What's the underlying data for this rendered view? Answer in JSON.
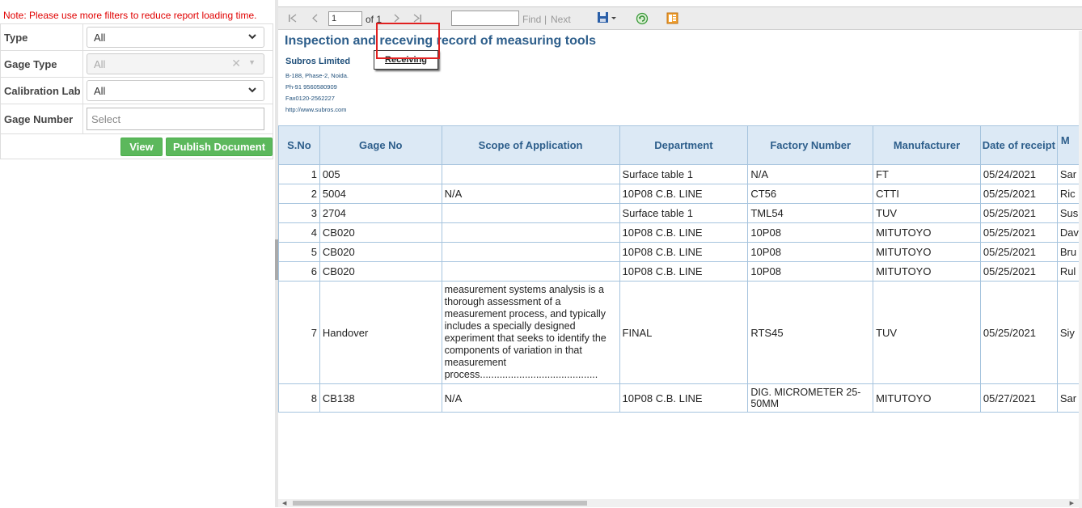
{
  "note": "Note: Please use more filters to reduce report loading time.",
  "filters": [
    {
      "label": "Type",
      "value": "All"
    },
    {
      "label": "Gage Type",
      "value": "All"
    },
    {
      "label": "Calibration Lab",
      "value": "All"
    },
    {
      "label": "Gage Number",
      "placeholder": "Select"
    }
  ],
  "buttons": {
    "view": "View",
    "publish": "Publish Document"
  },
  "toolbar": {
    "page_value": "1",
    "of_label": "of 1",
    "find_label": "Find",
    "separator": "|",
    "next_label": "Next",
    "icons": [
      "first-page-icon",
      "prev-page-icon",
      "next-page-icon",
      "last-page-icon",
      "export-save-icon",
      "refresh-icon",
      "print-layout-icon"
    ]
  },
  "report": {
    "title": "Inspection and receving record of measuring tools",
    "company": {
      "name": "Subros Limited",
      "address": "B-188, Phase-2, Noida.",
      "phone": "Ph-91 9560580909",
      "fax": "Fax0120-2562227",
      "web": "http://www.subros.com"
    },
    "receiving_tab": "Receiving",
    "columns": [
      "S.No",
      "Gage No",
      "Scope of Application",
      "Department",
      "Factory Number",
      "Manufacturer",
      "Date of receipt",
      "M"
    ],
    "rows": [
      {
        "sn": "1",
        "gage": "005",
        "scope": "",
        "dept": "Surface table 1",
        "factory": "N/A",
        "mfr": "FT",
        "date": "05/24/2021",
        "extra": "Sar"
      },
      {
        "sn": "2",
        "gage": "5004",
        "scope": "N/A",
        "dept": "10P08 C.B. LINE",
        "factory": "CT56",
        "mfr": "CTTI",
        "date": "05/25/2021",
        "extra": "Ric"
      },
      {
        "sn": "3",
        "gage": "2704",
        "scope": "",
        "dept": "Surface table 1",
        "factory": "TML54",
        "mfr": "TUV",
        "date": "05/25/2021",
        "extra": "Sus"
      },
      {
        "sn": "4",
        "gage": "CB020",
        "scope": "",
        "dept": "10P08 C.B. LINE",
        "factory": "10P08",
        "mfr": "MITUTOYO",
        "date": "05/25/2021",
        "extra": "Dav"
      },
      {
        "sn": "5",
        "gage": "CB020",
        "scope": "",
        "dept": "10P08 C.B. LINE",
        "factory": "10P08",
        "mfr": "MITUTOYO",
        "date": "05/25/2021",
        "extra": "Bru"
      },
      {
        "sn": "6",
        "gage": "CB020",
        "scope": "",
        "dept": "10P08 C.B. LINE",
        "factory": "10P08",
        "mfr": "MITUTOYO",
        "date": "05/25/2021",
        "extra": "Rul"
      },
      {
        "sn": "7",
        "gage": "Handover",
        "scope": " measurement systems analysis is a thorough assessment of a measurement process, and typically includes a specially designed experiment that seeks to identify the components of variation in that measurement process..........................................",
        "dept": "FINAL",
        "factory": "RTS45",
        "mfr": "TUV",
        "date": "05/25/2021",
        "extra": "Siy"
      },
      {
        "sn": "8",
        "gage": "CB138",
        "scope": "N/A",
        "dept": "10P08 C.B. LINE",
        "factory": "DIG. MICROMETER 25-50MM",
        "mfr": "MITUTOYO",
        "date": "05/27/2021",
        "extra": "Sar"
      }
    ]
  },
  "colors": {
    "note": "#e00000",
    "button": "#5cb85c",
    "header_bg": "#dce9f5",
    "header_text": "#2d5e8b",
    "highlight": "#e02020"
  }
}
